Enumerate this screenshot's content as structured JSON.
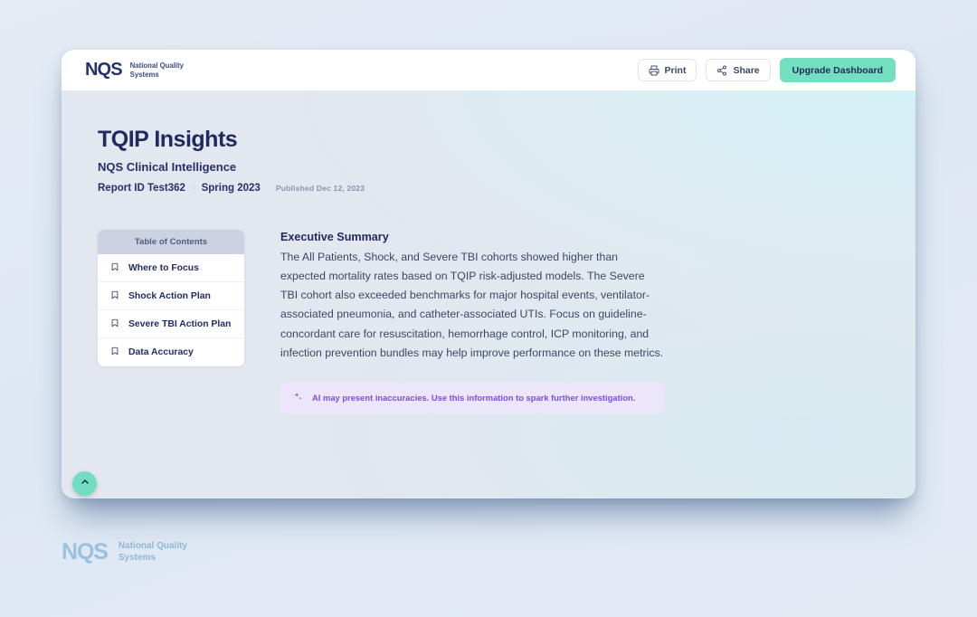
{
  "brand": {
    "mark": "NQS",
    "name": "National Quality\nSystems"
  },
  "topbar": {
    "print_label": "Print",
    "share_label": "Share",
    "upgrade_label": "Upgrade Dashboard",
    "print_icon": "printer-icon",
    "share_icon": "share-nodes-icon",
    "accent_color": "#73dfc0"
  },
  "report": {
    "title": "TQIP Insights",
    "subtitle": "NQS Clinical Intelligence",
    "report_id": "Report ID Test362",
    "separator": "·",
    "period": "Spring 2023",
    "published": "Published Dec 12, 2023"
  },
  "toc": {
    "heading": "Table of Contents",
    "items": [
      {
        "label": "Where to Focus",
        "icon": "bookmark-icon"
      },
      {
        "label": "Shock Action Plan",
        "icon": "bookmark-icon"
      },
      {
        "label": "Severe TBI Action Plan",
        "icon": "bookmark-icon"
      },
      {
        "label": "Data Accuracy",
        "icon": "bookmark-icon"
      }
    ]
  },
  "summary": {
    "heading": "Executive Summary",
    "body": "The All Patients, Shock, and Severe TBI cohorts showed higher than expected mortality rates based on TQIP risk-adjusted models. The Severe TBI cohort also exceeded benchmarks for major hospital events, ventilator-associated pneumonia, and catheter-associated UTIs. Focus on guideline-concordant care for resuscitation, hemorrhage control, ICP monitoring, and infection prevention bundles may help improve performance on these metrics."
  },
  "ai_note": {
    "icon": "sparkle-icon",
    "text": "AI may present inaccuracies. Use this information to spark further investigation.",
    "color": "#7a4fe0"
  },
  "scroll_top": {
    "icon": "chevron-up-icon",
    "color": "#72ddc0"
  },
  "footer": {
    "mark": "NQS",
    "name": "National Quality\nSystems"
  }
}
